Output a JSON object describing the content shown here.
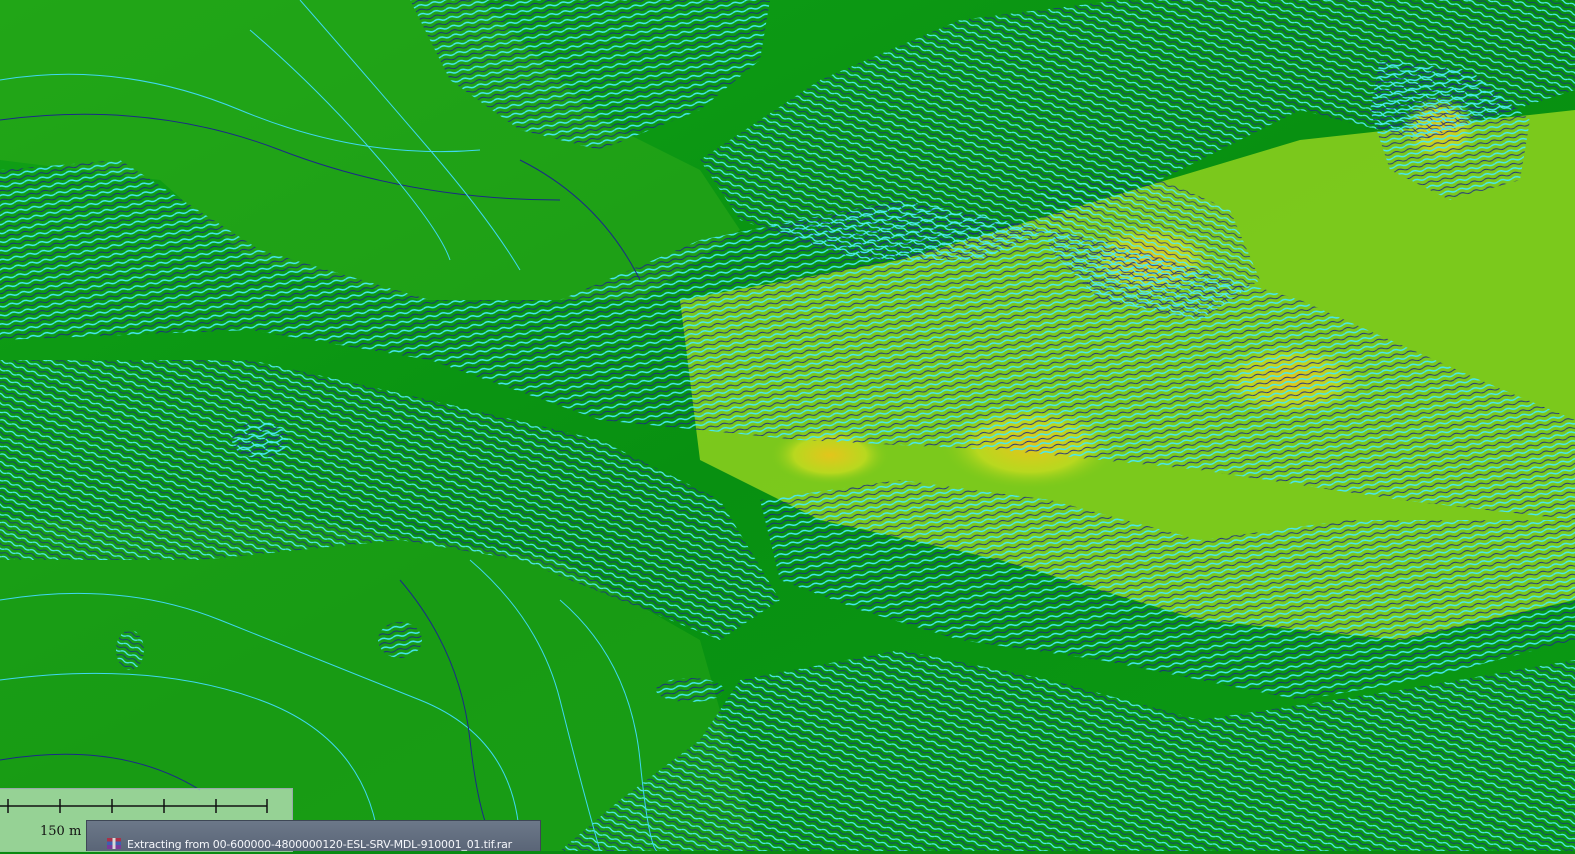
{
  "map": {
    "colors": {
      "lowland": "#0a9612",
      "lowland_light": "#3cb91e",
      "mid_slope": "#8fd21f",
      "highland": "#d6d41e",
      "peak": "#e0a019",
      "contour_minor": "#43e6f5",
      "contour_major": "#11165e"
    }
  },
  "scale_bar": {
    "label": "150 m",
    "tick_count": 6
  },
  "progress_window": {
    "title": "Extracting from 00-600000-4800000120-ESL-SRV-MDL-910001_01.tif.rar",
    "icon": "winrar-archive-icon"
  }
}
